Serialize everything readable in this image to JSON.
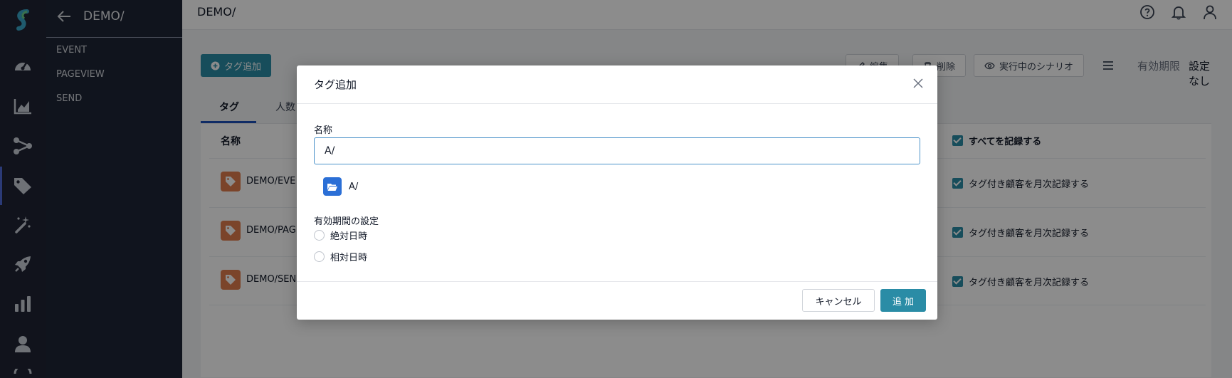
{
  "app": {
    "brand": "S"
  },
  "rail": {
    "icons": [
      "dashboard-icon",
      "chart-icon",
      "share-icon",
      "tag-icon",
      "magic-wand-icon",
      "rocket-icon",
      "bar-chart-icon",
      "user-icon",
      "more-icon"
    ],
    "active": "tag-icon",
    "accent": "#4f6bd8"
  },
  "subnav": {
    "title": "DEMO/",
    "items": [
      {
        "label": "EVENT"
      },
      {
        "label": "PAGEVIEW"
      },
      {
        "label": "SEND"
      }
    ]
  },
  "topbar": {
    "breadcrumb": "DEMO/",
    "icons": [
      "help-icon",
      "bell-icon",
      "user-icon"
    ]
  },
  "toolbar": {
    "add_tag_label": "タグ追加",
    "edit_label": "編集",
    "delete_label": "削除",
    "running_scenario_label": "実行中のシナリオ",
    "expiry_label": "有効期限",
    "expiry_value": "設定なし"
  },
  "tabs": [
    {
      "label": "タグ",
      "active": true
    },
    {
      "label": "人数",
      "active": false
    }
  ],
  "table": {
    "header_name": "名称",
    "header_record_all": "すべてを記録する",
    "rows": [
      {
        "name": "DEMO/EVE",
        "record": "タグ付き顧客を月次記録する"
      },
      {
        "name": "DEMO/PAG",
        "record": "タグ付き顧客を月次記録する"
      },
      {
        "name": "DEMO/SEN",
        "record": "タグ付き顧客を月次記録する"
      }
    ]
  },
  "modal": {
    "title": "タグ追加",
    "name_label": "名称",
    "name_value": "A/",
    "suggestion": "A/",
    "expiry_setting_label": "有効期間の設定",
    "radio_absolute": "絶対日時",
    "radio_relative": "相対日時",
    "cancel_label": "キャンセル",
    "add_label": "追 加"
  },
  "colors": {
    "primary": "#2a8ca6",
    "sidebar": "#1f2433",
    "tag_icon": "#e07d4d",
    "folder_icon": "#2b6fd6"
  }
}
